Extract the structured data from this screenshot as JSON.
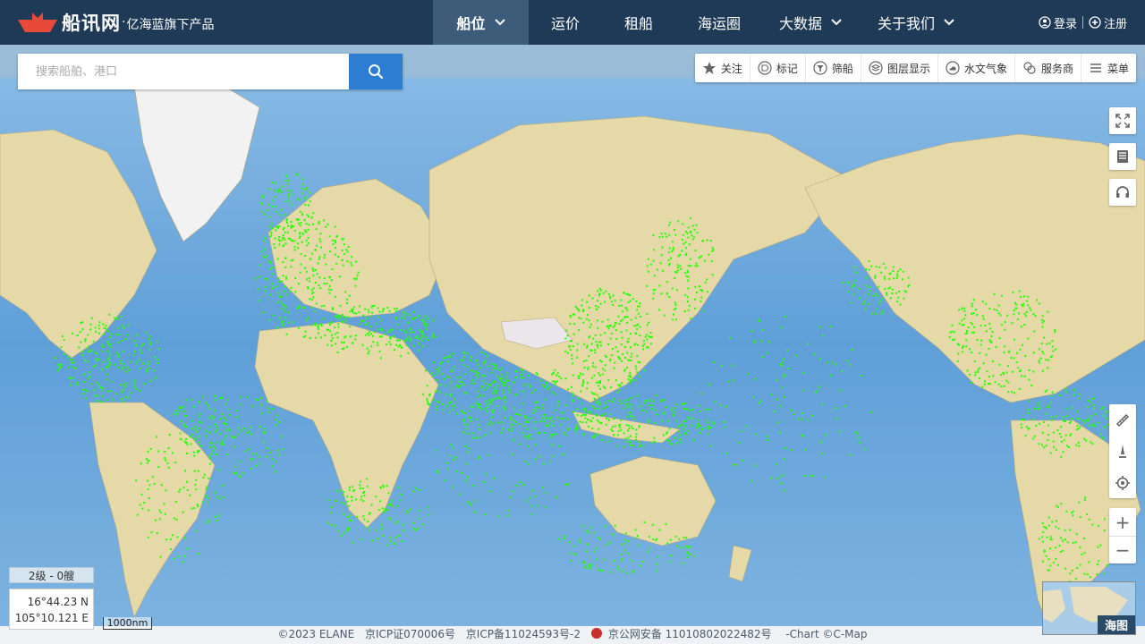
{
  "brand": {
    "name": "船讯网",
    "dot": "·",
    "tagline": "亿海蓝旗下产品"
  },
  "nav": {
    "items": [
      {
        "label": "船位",
        "active": true,
        "dropdown": true
      },
      {
        "label": "运价",
        "active": false,
        "dropdown": false
      },
      {
        "label": "租船",
        "active": false,
        "dropdown": false
      },
      {
        "label": "海运圈",
        "active": false,
        "dropdown": false
      },
      {
        "label": "大数据",
        "active": false,
        "dropdown": true
      },
      {
        "label": "关于我们",
        "active": false,
        "dropdown": true
      }
    ],
    "login": "登录",
    "register": "注册"
  },
  "search": {
    "placeholder": "搜索船舶、港口",
    "value": ""
  },
  "toolbar": {
    "items": [
      {
        "label": "关注",
        "icon": "star-icon"
      },
      {
        "label": "标记",
        "icon": "tag-icon"
      },
      {
        "label": "筛船",
        "icon": "filter-icon"
      },
      {
        "label": "图层显示",
        "icon": "layers-icon"
      },
      {
        "label": "水文气象",
        "icon": "weather-icon"
      },
      {
        "label": "服务商",
        "icon": "service-icon"
      },
      {
        "label": "菜单",
        "icon": "menu-icon"
      }
    ]
  },
  "map": {
    "level": "2级 - 0艘",
    "lat": "16°44.23 N",
    "lon": "105°10.121 E",
    "scale": "1000nm",
    "minimap_label": "海图",
    "colors": {
      "ocean": "#6fa8d9",
      "land": "#e8dcae",
      "ship": "#22ff00"
    }
  },
  "footer": {
    "copyright": "©2023 ELANE",
    "icp1": "京ICP证070006号",
    "icp2": "京ICP备11024593号-2",
    "police": "京公网安备 11010802022482号",
    "chart": "-Chart ©C-Map"
  }
}
